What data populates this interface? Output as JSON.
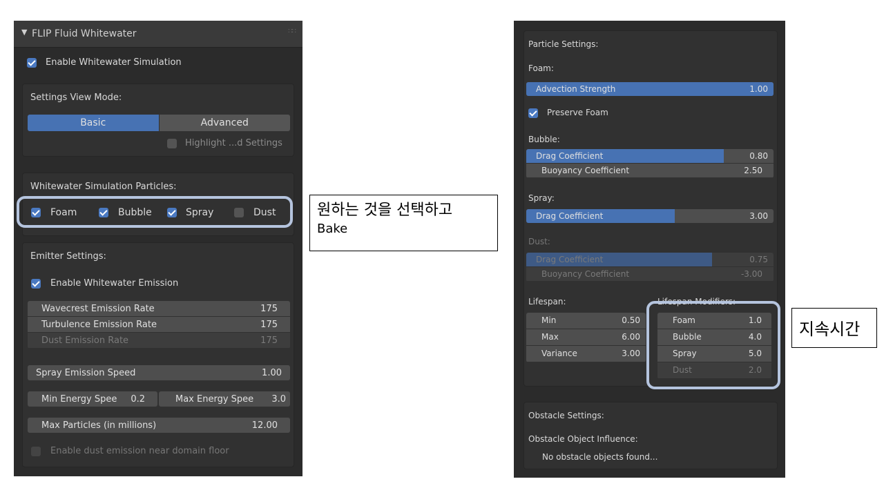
{
  "left_panel": {
    "header": {
      "title": "FLIP Fluid Whitewater"
    },
    "enable_sim": {
      "label": "Enable Whitewater Simulation",
      "checked": true
    },
    "view_mode": {
      "title": "Settings View Mode:",
      "basic_label": "Basic",
      "advanced_label": "Advanced",
      "selected": "Basic",
      "highlight_label": "Highlight ...d Settings"
    },
    "particles": {
      "title": "Whitewater Simulation Particles:",
      "foam": "Foam",
      "bubble": "Bubble",
      "spray": "Spray",
      "dust": "Dust"
    },
    "emitter": {
      "title": "Emitter Settings:",
      "enable_emission": "Enable Whitewater Emission",
      "wavecrest_label": "Wavecrest Emission Rate",
      "wavecrest_value": "175",
      "turbulence_label": "Turbulence Emission Rate",
      "turbulence_value": "175",
      "dust_rate_label": "Dust Emission Rate",
      "dust_rate_value": "175",
      "spray_speed_label": "Spray Emission Speed",
      "spray_speed_value": "1.00",
      "min_energy_label": "Min Energy Spee",
      "min_energy_value": "0.2",
      "max_energy_label": "Max Energy Spee",
      "max_energy_value": "3.0",
      "max_particles_label": "Max Particles (in millions)",
      "max_particles_value": "12.00",
      "dust_floor_label": "Enable dust emission near domain floor"
    }
  },
  "annotation_bake": {
    "line1": "원하는 것을 선택하고",
    "line2": "Bake"
  },
  "right_panel": {
    "particle_settings_title": "Particle Settings:",
    "foam": {
      "title": "Foam:",
      "advection_label": "Advection Strength",
      "advection_value": "1.00",
      "advection_fraction": 1.0,
      "preserve_label": "Preserve Foam"
    },
    "bubble": {
      "title": "Bubble:",
      "drag_label": "Drag Coefficient",
      "drag_value": "0.80",
      "drag_fraction": 0.8,
      "buoyancy_label": "Buoyancy Coefficient",
      "buoyancy_value": "2.50"
    },
    "spray": {
      "title": "Spray:",
      "drag_label": "Drag Coefficient",
      "drag_value": "3.00",
      "drag_fraction": 0.6
    },
    "dust": {
      "title": "Dust:",
      "drag_label": "Drag Coefficient",
      "drag_value": "0.75",
      "drag_fraction": 0.75,
      "buoyancy_label": "Buoyancy Coefficient",
      "buoyancy_value": "-3.00"
    },
    "lifespan": {
      "title": "Lifespan:",
      "min_label": "Min",
      "min_value": "0.50",
      "max_label": "Max",
      "max_value": "6.00",
      "variance_label": "Variance",
      "variance_value": "3.00"
    },
    "modifiers": {
      "title": "Lifespan Modifiers:",
      "foam_label": "Foam",
      "foam_value": "1.0",
      "bubble_label": "Bubble",
      "bubble_value": "4.0",
      "spray_label": "Spray",
      "spray_value": "5.0",
      "dust_label": "Dust",
      "dust_value": "2.0"
    },
    "obstacle": {
      "title": "Obstacle Settings:",
      "influence_label": "Obstacle Object Influence:",
      "none_found": "No obstacle objects found..."
    }
  },
  "annotation_lifespan": {
    "text": "지속시간"
  },
  "colors": {
    "accent": "#4772b3",
    "panel": "#2b2b2b",
    "highlight_outline": "#b5c4de"
  }
}
